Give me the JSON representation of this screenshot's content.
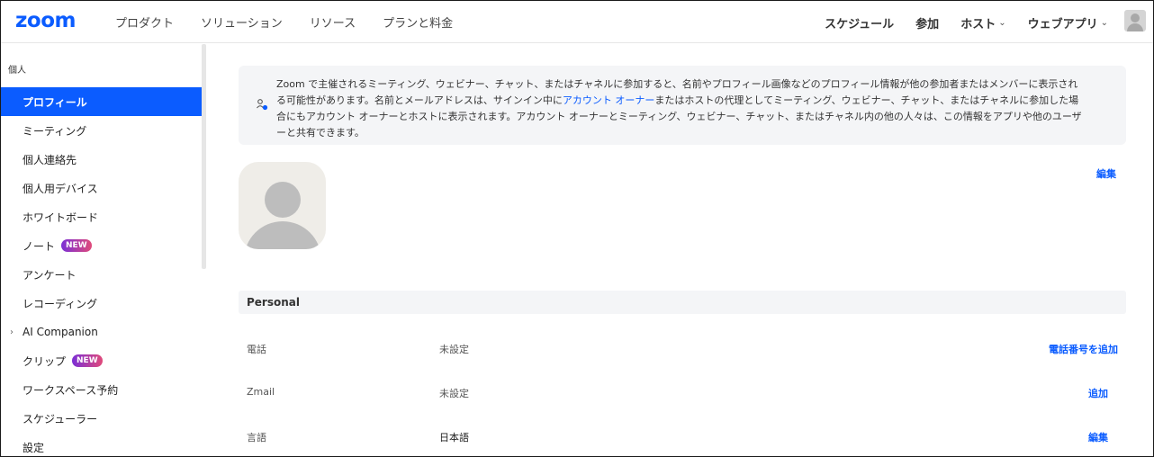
{
  "header": {
    "logo": "zoom",
    "nav_left": [
      "プロダクト",
      "ソリューション",
      "リソース",
      "プランと料金"
    ],
    "nav_right": [
      {
        "label": "スケジュール",
        "dropdown": false
      },
      {
        "label": "参加",
        "dropdown": false
      },
      {
        "label": "ホスト",
        "dropdown": true
      },
      {
        "label": "ウェブアプリ",
        "dropdown": true
      }
    ]
  },
  "sidebar": {
    "section": "個人",
    "items": [
      {
        "label": "プロフィール",
        "active": true
      },
      {
        "label": "ミーティング"
      },
      {
        "label": "個人連絡先"
      },
      {
        "label": "個人用デバイス"
      },
      {
        "label": "ホワイトボード"
      },
      {
        "label": "ノート",
        "badge": "NEW"
      },
      {
        "label": "アンケート"
      },
      {
        "label": "レコーディング"
      },
      {
        "label": "AI Companion",
        "expandable": true
      },
      {
        "label": "クリップ",
        "badge": "NEW"
      },
      {
        "label": "ワークスペース予約"
      },
      {
        "label": "スケジューラー"
      },
      {
        "label": "設定"
      }
    ]
  },
  "notice": {
    "text_before": "Zoom で主催されるミーティング、ウェビナー、チャット、またはチャネルに参加すると、名前やプロフィール画像などのプロフィール情報が他の参加者またはメンバーに表示される可能性があります。名前とメールアドレスは、サインイン中に",
    "link": "アカウント オーナー",
    "text_after": "またはホストの代理としてミーティング、ウェビナー、チャット、またはチャネルに参加した場合にもアカウント オーナーとホストに表示されます。アカウント オーナーとミーティング、ウェビナー、チャット、またはチャネル内の他の人々は、この情報をアプリや他のユーザーと共有できます。"
  },
  "profile": {
    "edit_label": "編集"
  },
  "personal": {
    "section_title": "Personal",
    "rows": [
      {
        "label": "電話",
        "value": "未設定",
        "action": "電話番号を追加"
      },
      {
        "label": "Zmail",
        "value": "未設定",
        "action": "追加"
      },
      {
        "label": "言語",
        "value": "日本語",
        "action": "編集"
      }
    ]
  }
}
